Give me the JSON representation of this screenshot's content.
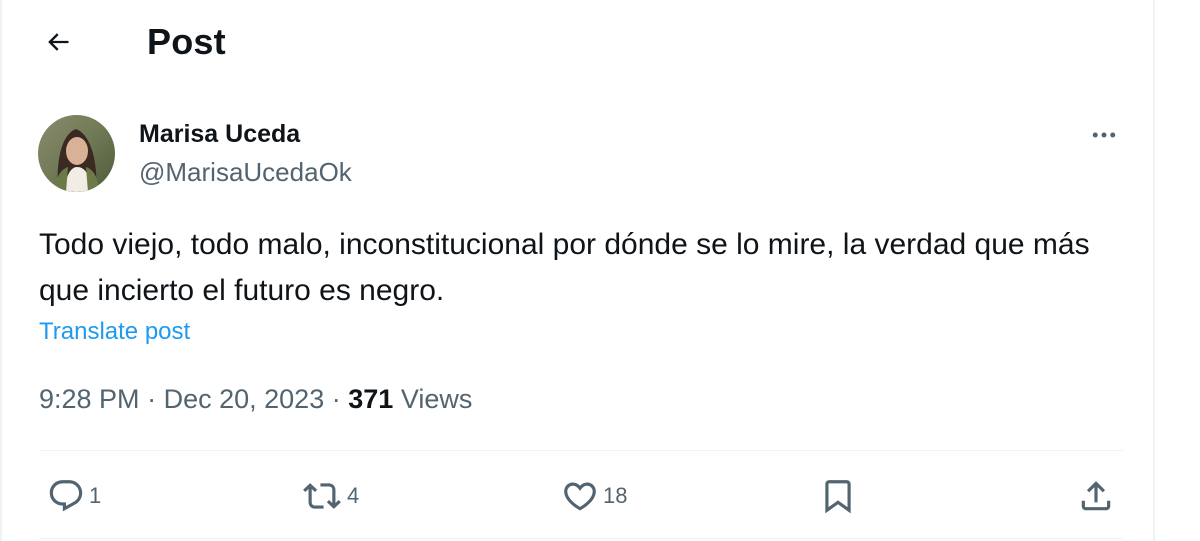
{
  "header": {
    "back_icon": "arrow-left-icon",
    "title": "Post"
  },
  "author": {
    "name": "Marisa Uceda",
    "handle": "@MarisaUcedaOk",
    "avatar_icon": "profile-photo"
  },
  "post": {
    "text": "Todo viejo, todo malo, inconstitucional por dónde se lo mire, la verdad que más que incierto el futuro es negro.",
    "translate_label": "Translate post",
    "time": "9:28 PM",
    "separator": "·",
    "date": "Dec 20, 2023",
    "views_count": "371",
    "views_label": "Views"
  },
  "actions": {
    "reply": {
      "icon": "reply-icon",
      "count": "1"
    },
    "repost": {
      "icon": "repost-icon",
      "count": "4"
    },
    "like": {
      "icon": "heart-icon",
      "count": "18"
    },
    "bookmark": {
      "icon": "bookmark-icon"
    },
    "share": {
      "icon": "share-icon"
    }
  },
  "colors": {
    "text": "#0f1419",
    "secondary": "#536471",
    "link": "#1d9bf0",
    "border": "#eff3f4"
  }
}
